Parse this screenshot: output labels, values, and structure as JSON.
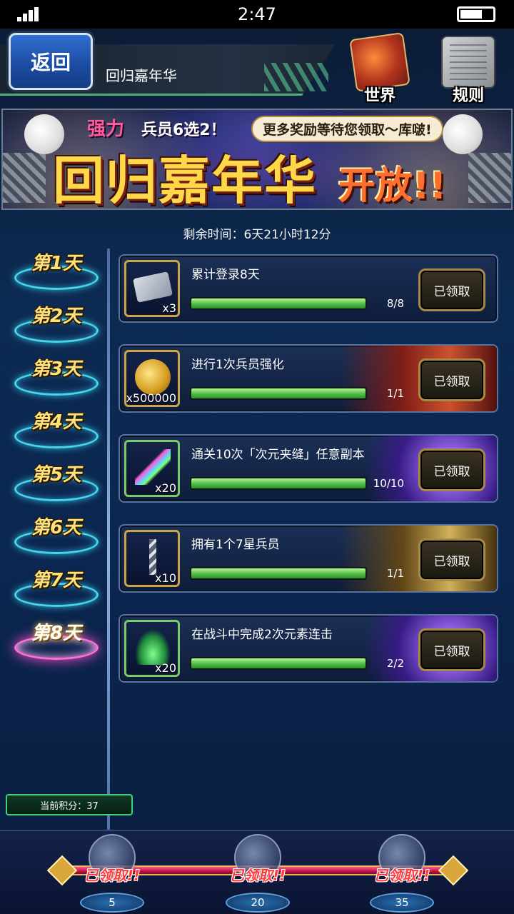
{
  "status_bar": {
    "time": "2:47"
  },
  "header": {
    "back_label": "返回",
    "title": "回归嘉年华",
    "world_label": "世界",
    "rules_label": "规则"
  },
  "banner": {
    "sub_highlight": "强力",
    "sub_rest": "兵员6选2！",
    "pill": "更多奖励等待您领取～库啵!",
    "main": "回归嘉年华",
    "open": "开放!!"
  },
  "remaining_time": "剩余时间：6天21小时12分",
  "days": [
    "第1天",
    "第2天",
    "第3天",
    "第4天",
    "第5天",
    "第6天",
    "第7天",
    "第8天"
  ],
  "active_day": "第8天",
  "tasks": [
    {
      "title": "累计登录8天",
      "qty": "x3",
      "progress_text": "8/8",
      "progress": 1.0,
      "claim": "已领取",
      "item_icon": "ticket-30-icon"
    },
    {
      "title": "进行1次兵员强化",
      "qty": "x500000",
      "progress_text": "1/1",
      "progress": 1.0,
      "claim": "已领取",
      "item_icon": "gil-coin-icon"
    },
    {
      "title": "通关10次「次元夹缝」任意副本",
      "qty": "x20",
      "progress_text": "10/10",
      "progress": 1.0,
      "claim": "已领取",
      "item_icon": "rainbow-crystal-icon"
    },
    {
      "title": "拥有1个7星兵员",
      "qty": "x10",
      "progress_text": "1/1",
      "progress": 1.0,
      "claim": "已领取",
      "item_icon": "silver-weapon-icon"
    },
    {
      "title": "在战斗中完成2次元素连击",
      "qty": "x20",
      "progress_text": "2/2",
      "progress": 1.0,
      "claim": "已领取",
      "item_icon": "leaf-sprout-icon"
    }
  ],
  "points_label": "当前积分：37",
  "rewards": [
    {
      "score": "5",
      "stamp": "已领取!!"
    },
    {
      "score": "20",
      "stamp": "已领取!!"
    },
    {
      "score": "35",
      "stamp": "已领取!!"
    }
  ],
  "colors": {
    "progress_green": "#58c24a",
    "claim_gold": "#a88a45",
    "stamp_red": "#ff3a3a"
  }
}
